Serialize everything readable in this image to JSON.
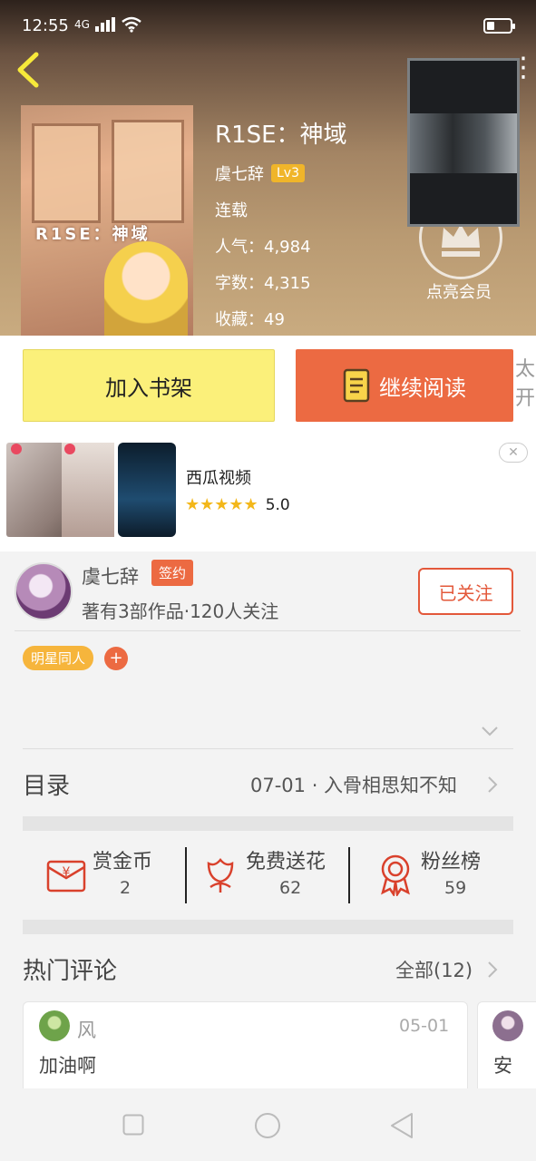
{
  "status_bar": {
    "time": "12:55",
    "network": "4G"
  },
  "book": {
    "title": "R1SE：神域",
    "cover_title": "R1SE：神域",
    "author": "虞七辞",
    "level": "Lv3",
    "status": "连载",
    "popularity": "人气：4,984",
    "word_count": "字数：4,315",
    "favorites": "收藏：49"
  },
  "vip": {
    "label": "点亮会员"
  },
  "actions": {
    "add_shelf": "加入书架",
    "continue_read": "继续阅读",
    "side_text_1": "太师",
    "side_text_2": "开,"
  },
  "ad": {
    "title": "西瓜视频",
    "stars": "★★★★★",
    "rating": "5.0",
    "close": "✕"
  },
  "author_section": {
    "name": "虞七辞",
    "badge": "签约",
    "description": "著有3部作品·120人关注",
    "follow_button": "已关注",
    "tag": "明星同人",
    "tag_add": "+"
  },
  "toc": {
    "title": "目录",
    "latest": "07-01 · 入骨相思知不知"
  },
  "stats": [
    {
      "label": "赏金币",
      "value": "2"
    },
    {
      "label": "免费送花",
      "value": "62"
    },
    {
      "label": "粉丝榜",
      "value": "59"
    }
  ],
  "comments_section": {
    "title": "热门评论",
    "all_label": "全部(12)"
  },
  "comments": [
    {
      "name": "风",
      "date": "05-01",
      "text": "加油啊"
    },
    {
      "text": "安"
    }
  ],
  "colors": {
    "accent": "#ec6a42",
    "shelf_button": "#fbf07a",
    "tag": "#f6b53c",
    "star": "#f3b71a"
  }
}
